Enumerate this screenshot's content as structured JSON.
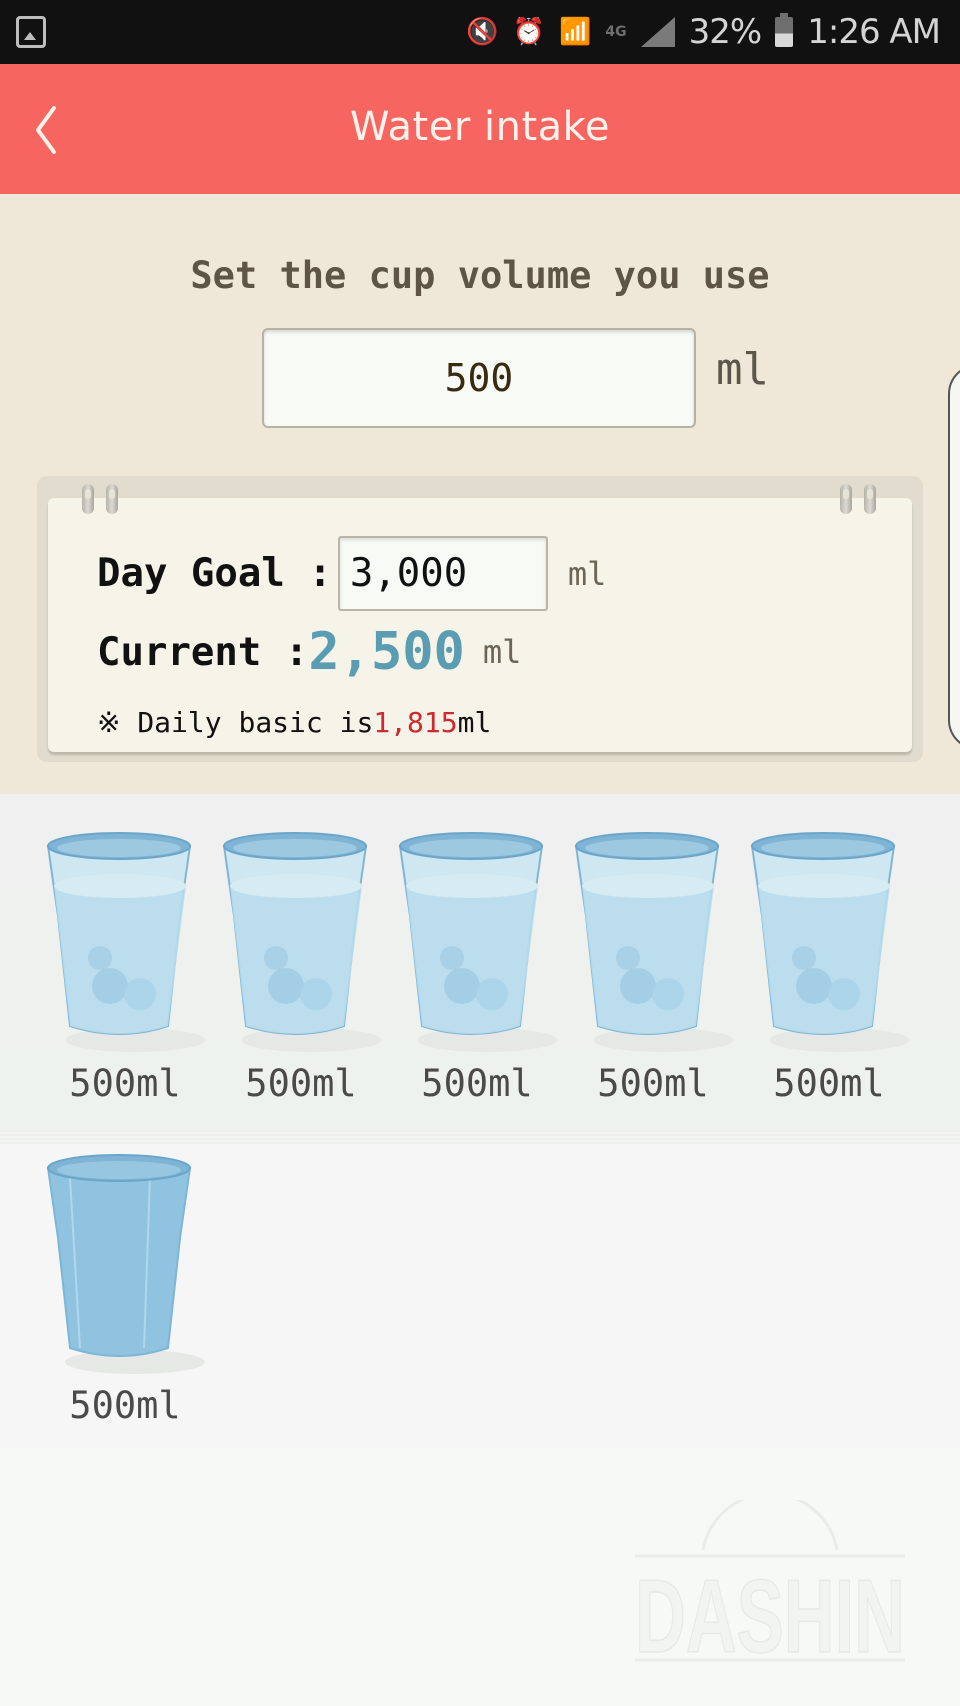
{
  "status_bar": {
    "left_icon": "gallery-icon",
    "icons": [
      "vibrate-mute-icon",
      "alarm-icon",
      "wifi-icon",
      "lte-icon",
      "signal-icon"
    ],
    "battery_percent": "32%",
    "time": "1:26 AM"
  },
  "header": {
    "back_icon": "chevron-left-icon",
    "title": "Water intake"
  },
  "cup_settings": {
    "label": "Set the cup volume you use",
    "volume_value": "500",
    "unit": "ml"
  },
  "goal_card": {
    "day_goal_label": "Day Goal :",
    "day_goal_value": "3,000",
    "day_goal_unit": "ml",
    "current_label": "Current :",
    "current_value": "2,500",
    "current_unit": "ml",
    "note_prefix": "※ Daily basic is",
    "note_value": "1,815",
    "note_suffix": "ml"
  },
  "cups": [
    {
      "label": "500ml",
      "state": "filled"
    },
    {
      "label": "500ml",
      "state": "filled"
    },
    {
      "label": "500ml",
      "state": "filled"
    },
    {
      "label": "500ml",
      "state": "filled"
    },
    {
      "label": "500ml",
      "state": "filled"
    },
    {
      "label": "500ml",
      "state": "empty"
    }
  ],
  "watermark": "DASHIN",
  "colors": {
    "header": "#f76560",
    "settings_bg": "#efe7d7",
    "current_value": "#5a9db3",
    "note_value": "#d0282e",
    "cup_blue": "#8fc3e0"
  }
}
